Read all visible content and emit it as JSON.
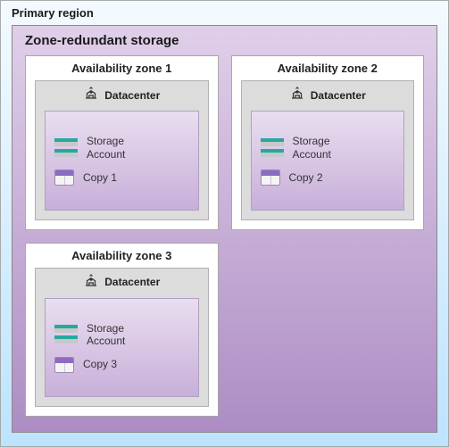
{
  "region": {
    "label": "Primary region"
  },
  "zrs": {
    "label": "Zone-redundant storage"
  },
  "zones": [
    {
      "label": "Availability zone 1",
      "datacenter_label": "Datacenter",
      "storage_label": "Storage\nAccount",
      "copy_label": "Copy 1"
    },
    {
      "label": "Availability zone 2",
      "datacenter_label": "Datacenter",
      "storage_label": "Storage\nAccount",
      "copy_label": "Copy 2"
    },
    {
      "label": "Availability zone 3",
      "datacenter_label": "Datacenter",
      "storage_label": "Storage\nAccount",
      "copy_label": "Copy 3"
    }
  ]
}
